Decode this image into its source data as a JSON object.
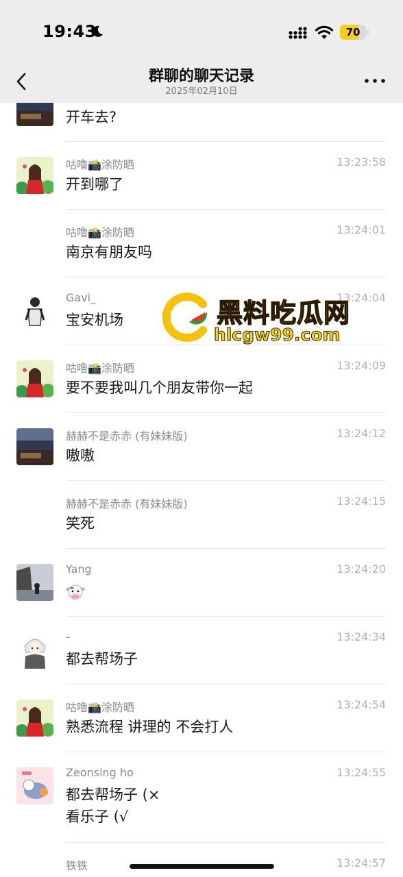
{
  "status_bar": {
    "time": "19:43",
    "battery_level": 70,
    "battery_text": "70",
    "icons": [
      "moon-icon",
      "signal-icon",
      "wifi-icon",
      "battery-icon"
    ]
  },
  "nav": {
    "title": "群聊的聊天记录",
    "subtitle": "2025年02月10日",
    "back_icon": "chevron-left-icon",
    "more_icon": "more-icon"
  },
  "messages": [
    {
      "sender": "",
      "time": "",
      "text": "开车去?",
      "avatar": "seascape"
    },
    {
      "sender": "咕噜📸涂防晒",
      "time": "13:23:58",
      "text": "开到哪了",
      "avatar": "girl"
    },
    {
      "sender": "咕噜📸涂防晒",
      "time": "13:24:01",
      "text": "南京有朋友吗",
      "avatar": ""
    },
    {
      "sender": "Gavi_",
      "time": "13:24:04",
      "text": "宝安机场",
      "avatar": "man"
    },
    {
      "sender": "咕噜📸涂防晒",
      "time": "13:24:09",
      "text": "要不要我叫几个朋友带你一起",
      "avatar": "girl"
    },
    {
      "sender": "赫赫不是赤赤 (有妹妹版)",
      "time": "13:24:12",
      "text": "嗷嗷",
      "avatar": "seascape"
    },
    {
      "sender": "赫赫不是赤赤 (有妹妹版)",
      "time": "13:24:15",
      "text": "笑死",
      "avatar": ""
    },
    {
      "sender": "Yang",
      "time": "13:24:20",
      "text": "",
      "emoji": "cow-face-icon",
      "avatar": "rock"
    },
    {
      "sender": "-",
      "time": "13:24:34",
      "text": "都去帮场子",
      "avatar": "anime"
    },
    {
      "sender": "咕噜📸涂防晒",
      "time": "13:24:54",
      "text": "熟悉流程 讲理的 不会打人",
      "avatar": "girl"
    },
    {
      "sender": "Zeonsing ho",
      "time": "13:24:55",
      "text": "都去帮场子 (×",
      "text2": "看乐子 (√",
      "avatar": "cat"
    },
    {
      "sender": "铁铁",
      "time": "13:24:57",
      "text": "",
      "avatar": "dark"
    }
  ],
  "watermark": {
    "title": "黑料吃瓜网",
    "url": "hlcgw99.com",
    "logo_icon": "watermelon-logo-icon"
  },
  "colors": {
    "header_bg": "#ededed",
    "text": "#191919",
    "meta": "#8a8a8a",
    "time": "#b2b2b2",
    "battery_fill": "#f4ce23",
    "watermark": "#f6d20a"
  }
}
